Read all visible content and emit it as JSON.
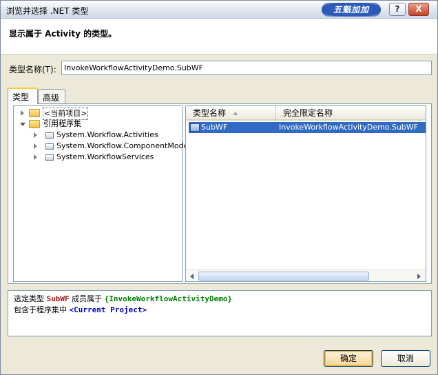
{
  "window": {
    "title": "浏览并选择 .NET 类型",
    "brand_badge": "五魁加加",
    "help_label": "?",
    "close_label": "X"
  },
  "header": {
    "title": "显示属于 Activity 的类型。"
  },
  "type_name": {
    "label": "类型名称(T):",
    "value": "InvokeWorkflowActivityDemo.SubWF"
  },
  "tabs": [
    {
      "label": "类型",
      "active": true
    },
    {
      "label": "高级",
      "active": false
    }
  ],
  "tree": {
    "items": [
      {
        "label": "<当前项目>",
        "icon": "folder-icon",
        "expanded": false
      },
      {
        "label": "引用程序集",
        "icon": "folder-icon",
        "expanded": true
      },
      {
        "label": "System.Workflow.Activities",
        "icon": "assembly-icon",
        "expanded": false
      },
      {
        "label": "System.Workflow.ComponentModel",
        "icon": "assembly-icon",
        "expanded": false
      },
      {
        "label": "System.WorkflowServices",
        "icon": "assembly-icon",
        "expanded": false
      }
    ]
  },
  "list": {
    "columns": [
      "类型名称",
      "完全限定名称"
    ],
    "sort_column": 0,
    "rows": [
      {
        "name": "SubWF",
        "qualified": "InvokeWorkflowActivityDemo.SubWF",
        "selected": true
      }
    ]
  },
  "description": {
    "line1_prefix": "选定类型",
    "line1_type": "SubWF",
    "line1_mid": "成员属于",
    "line1_namespace": "{InvokeWorkflowActivityDemo}",
    "line2_prefix": "包含于程序集中",
    "line2_assembly": "<Current Project>"
  },
  "buttons": {
    "ok": "确定",
    "cancel": "取消"
  },
  "colors": {
    "selection": "#316ac5",
    "type_red": "#a31515",
    "namespace_green": "#008000",
    "assembly_blue": "#0000cc",
    "default_button_border": "#f8b93c"
  }
}
